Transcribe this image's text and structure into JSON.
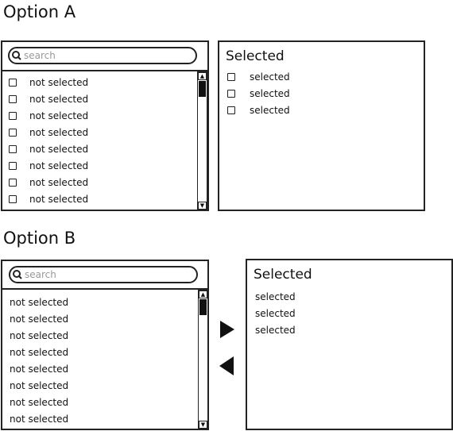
{
  "optionA": {
    "title": "Option A",
    "search": {
      "placeholder": "search"
    },
    "available_items": [
      "not selected",
      "not selected",
      "not selected",
      "not selected",
      "not selected",
      "not selected",
      "not selected",
      "not selected"
    ],
    "selected_panel": {
      "title": "Selected",
      "items": [
        "selected",
        "selected",
        "selected"
      ]
    }
  },
  "optionB": {
    "title": "Option B",
    "search": {
      "placeholder": "search"
    },
    "available_items": [
      "not selected",
      "not selected",
      "not selected",
      "not selected",
      "not selected",
      "not selected",
      "not selected",
      "not selected"
    ],
    "move_right_icon": "triangle-right-icon",
    "move_left_icon": "triangle-left-icon",
    "selected_panel": {
      "title": "Selected",
      "items": [
        "selected",
        "selected",
        "selected"
      ]
    }
  }
}
